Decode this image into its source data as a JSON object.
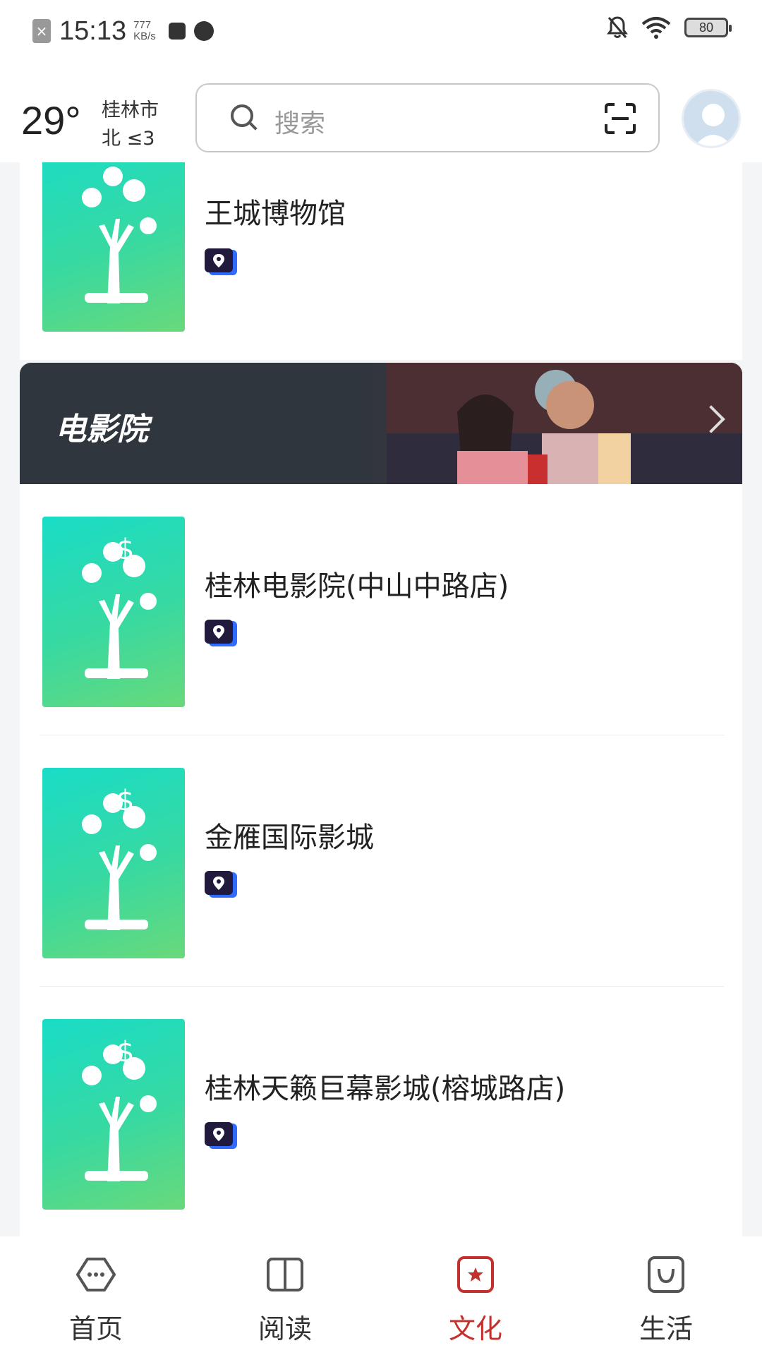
{
  "status_bar": {
    "time": "15:13",
    "net_speed_value": "777",
    "net_speed_unit": "KB/s",
    "battery": "80"
  },
  "header": {
    "temperature": "29°",
    "city": "桂林市",
    "wind": "北  ≤3",
    "search_placeholder": "搜索"
  },
  "top_item": {
    "name": "王城博物馆"
  },
  "section": {
    "title": "电影院"
  },
  "items": [
    {
      "name": "桂林电影院(中山中路店)"
    },
    {
      "name": "金雁国际影城"
    },
    {
      "name": "桂林天籁巨幕影城(榕城路店)"
    }
  ],
  "tabs": [
    {
      "label": "首页",
      "icon": "home-hexagon-icon"
    },
    {
      "label": "阅读",
      "icon": "book-icon"
    },
    {
      "label": "文化",
      "icon": "star-box-icon"
    },
    {
      "label": "生活",
      "icon": "shopping-bag-icon"
    }
  ],
  "colors": {
    "accent": "#c4302b",
    "thumb_gradient_start": "#19dcc7",
    "thumb_gradient_end": "#69d97a",
    "badge_dark": "#211a3d",
    "badge_blue": "#2f6bff"
  }
}
